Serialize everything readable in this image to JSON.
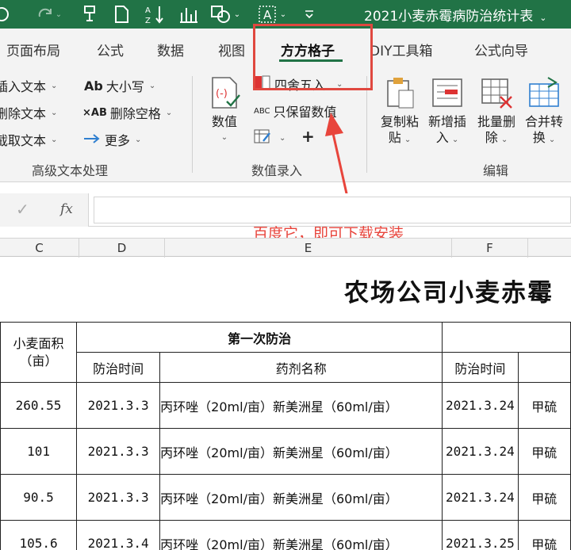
{
  "window": {
    "title": "2021小麦赤霉病防治统计表",
    "title_caret": "⌄"
  },
  "quick_access": [
    "redo",
    "format-painter",
    "new-document",
    "sort",
    "chart",
    "shapes",
    "select-text",
    "customize"
  ],
  "tabs": [
    {
      "label": "页面布局"
    },
    {
      "label": "公式"
    },
    {
      "label": "数据"
    },
    {
      "label": "视图"
    },
    {
      "label": "方方格子",
      "active": true
    },
    {
      "label": "DIY工具箱"
    },
    {
      "label": "公式向导"
    }
  ],
  "ribbon": {
    "text_group": {
      "items": [
        "插入文本",
        "删除文本",
        "截取文本"
      ],
      "case_label": "大小写",
      "case_icon": "Ab",
      "delete_space_label": "删除空格",
      "delete_space_icon": "×AB",
      "more_label": "更多",
      "group_label": "高级文本处理"
    },
    "value_group": {
      "big_button_label": "数值",
      "round_label": "四舍五入",
      "keep_value_label": "只保留数值",
      "keep_value_icon": "ABC",
      "plus_label": "+",
      "group_label": "数值录入"
    },
    "edit_group": {
      "buttons": [
        {
          "line1": "复制粘",
          "line2": "贴"
        },
        {
          "line1": "新增插",
          "line2": "入"
        },
        {
          "line1": "批量删",
          "line2": "除"
        },
        {
          "line1": "合并转",
          "line2": "换"
        }
      ],
      "group_label": "编辑"
    }
  },
  "annotation": {
    "note": "百度它，即可下载安装",
    "color": "#e8453c"
  },
  "formula_bar": {
    "fx_label": "fx",
    "value": ""
  },
  "columns": [
    "C",
    "D",
    "E",
    "F"
  ],
  "sheet": {
    "title": "农场公司小麦赤霉",
    "header1": {
      "area": "小麦面积（亩）",
      "first": "第一次防治"
    },
    "header2": {
      "time": "防治时间",
      "agent": "药剂名称",
      "time2": "防治时间"
    },
    "rows": [
      {
        "area": "260.55",
        "date1": "2021.3.3",
        "agent": "丙环唑（20ml/亩）新美洲星（60ml/亩）",
        "date2": "2021.3.24",
        "next": "甲硫"
      },
      {
        "area": "101",
        "date1": "2021.3.3",
        "agent": "丙环唑（20ml/亩）新美洲星（60ml/亩）",
        "date2": "2021.3.24",
        "next": "甲硫"
      },
      {
        "area": "90.5",
        "date1": "2021.3.3",
        "agent": "丙环唑（20ml/亩）新美洲星（60ml/亩）",
        "date2": "2021.3.24",
        "next": "甲硫"
      },
      {
        "area": "105.6",
        "date1": "2021.3.4",
        "agent": "丙环唑（20ml/亩）新美洲星（60ml/亩）",
        "date2": "2021.3.25",
        "next": "甲硫"
      }
    ]
  }
}
